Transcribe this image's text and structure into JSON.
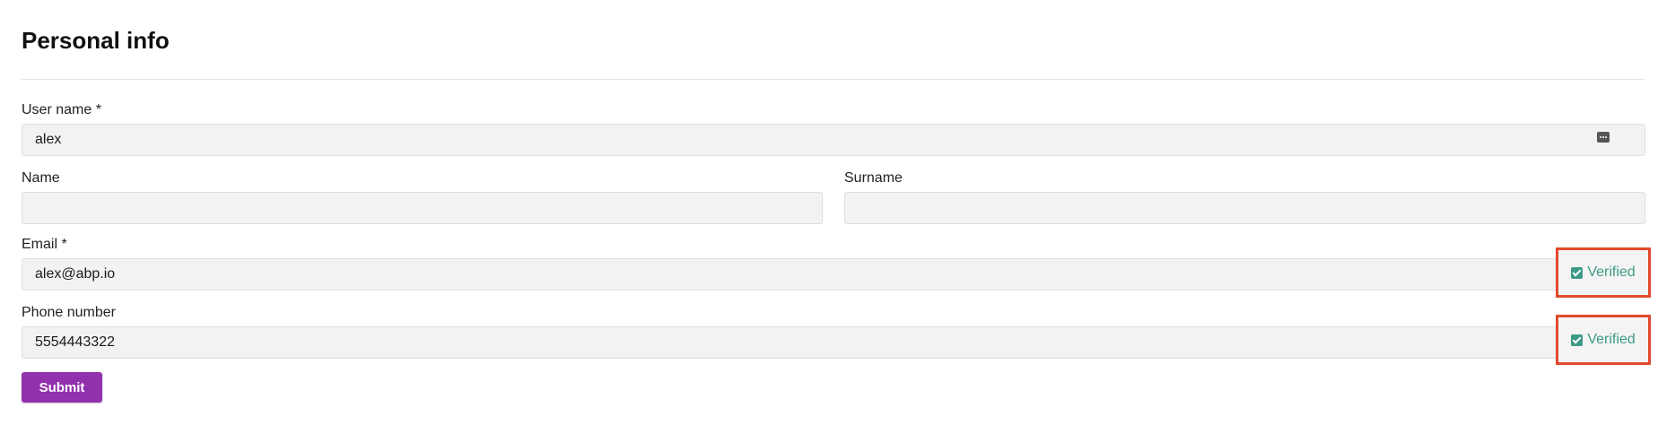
{
  "header": {
    "title": "Personal info"
  },
  "form": {
    "username": {
      "label": "User name *",
      "value": "alex",
      "trailing_icon": "password-manager-icon"
    },
    "name": {
      "label": "Name",
      "value": ""
    },
    "surname": {
      "label": "Surname",
      "value": ""
    },
    "email": {
      "label": "Email *",
      "value": "alex@abp.io",
      "verified_label": "Verified",
      "verified_icon": "checkbox-checked-icon"
    },
    "phone": {
      "label": "Phone number",
      "value": "5554443322",
      "verified_label": "Verified",
      "verified_icon": "checkbox-checked-icon"
    },
    "submit_label": "Submit"
  },
  "colors": {
    "accent": "#9231ad",
    "verified": "#3c9a86",
    "highlight": "#e2492e",
    "field_background": "#f2f2f2"
  }
}
